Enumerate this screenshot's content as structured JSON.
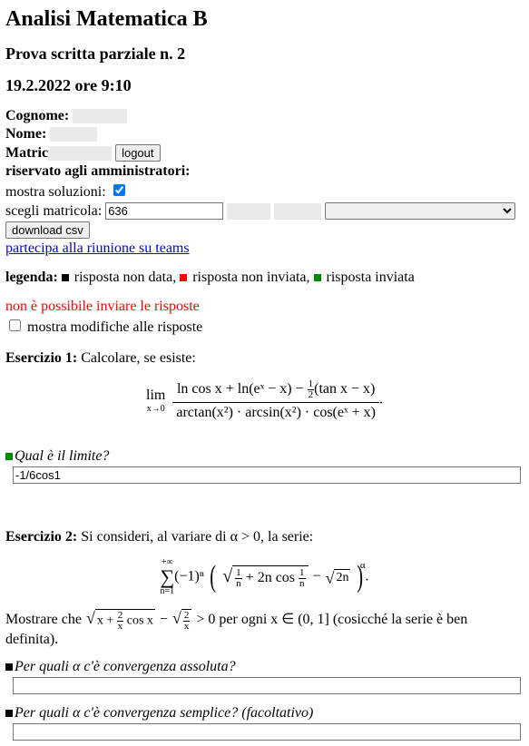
{
  "title": "Analisi Matematica B",
  "subtitle": "Prova scritta parziale n. 2",
  "datetime": "19.2.2022 ore 9:10",
  "labels": {
    "cognome": "Cognome:",
    "nome": "Nome:",
    "matric": "Matric",
    "logout": "logout",
    "admin": "riservato agli amministratori:",
    "show_solutions": "mostra soluzioni:",
    "choose_matricola": "scegli matricola:",
    "download_csv": "download csv",
    "teams_link": "partecipa alla riunione su teams",
    "legend_label": "legenda:",
    "legend_none": "risposta non data,",
    "legend_notsent": "risposta non inviata,",
    "legend_sent": "risposta inviata",
    "cannot_send": "non è possibile inviare le risposte",
    "show_mods": "mostra modifiche alle risposte"
  },
  "matricola_value": "636",
  "select_option": "",
  "ex1": {
    "heading": "Esercizio 1:",
    "text": "Calcolare, se esiste:",
    "lim_text": "lim",
    "lim_sub": "x→0",
    "numerator": "ln cos x + ln(eˣ − x) − ",
    "half_num": "1",
    "half_den": "2",
    "numerator_tail": "(tan x − x)",
    "denominator": "arctan(x²) · arcsin(x²) · cos(eˣ + x)",
    "trail_dot": ".",
    "question": "Qual è il limite?",
    "answer": "-1/6cos1"
  },
  "ex2": {
    "heading": "Esercizio 2:",
    "text_before_alpha": "Si consideri, al variare di ",
    "alpha_cond": "α > 0",
    "text_after_alpha": ", la serie:",
    "sum_top": "+∞",
    "sum_bot": "n=1",
    "sum_body_a": "(−1)ⁿ",
    "inner_a": "1",
    "inner_b": "n",
    "inner_mid": " + 2n cos ",
    "inner_c": "1",
    "inner_d": "n",
    "minus": " − ",
    "sqrt2n": "2n",
    "alpha_exp": "α",
    "trail_dot": ".",
    "show_prefix": "Mostrare che ",
    "show_mid": " > 0 per ogni x ∈ (0, 1] (cosicché la serie è ben definita).",
    "x_plus": "x + ",
    "frac2x_n": "2",
    "frac2x_d": "x",
    "cosx": " cos x",
    "q1": "Per quali α c'è convergenza assoluta?",
    "q2": "Per quali α c'è convergenza semplice? (facoltativo)"
  }
}
